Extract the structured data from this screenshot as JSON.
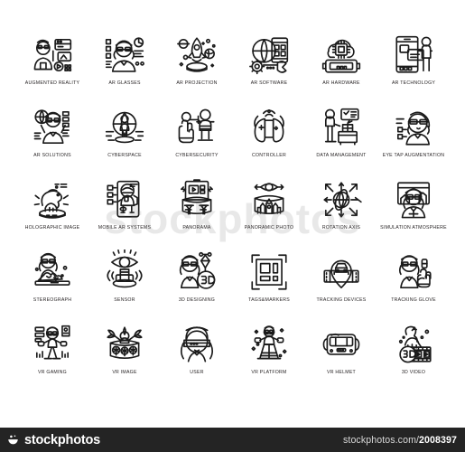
{
  "sheet": {
    "watermark_text": "stockphotos",
    "stroke_color": "#1a1a1a",
    "label_color": "#231f20",
    "background": "#ffffff"
  },
  "footer": {
    "background": "#242424",
    "brand_name": "stockphotos",
    "brand_mark": "smile-logo-icon",
    "url_prefix": "stockphotos.com/",
    "url_id": "2008397"
  },
  "grid": {
    "columns": 6,
    "rows": 5,
    "icons": [
      {
        "id": "augmented-reality",
        "icon": "man-vr-headset-dashboard-icon",
        "label": "AUGMENTED REALITY"
      },
      {
        "id": "ar-glasses",
        "icon": "woman-ar-glasses-icon",
        "label": "AR GLASSES"
      },
      {
        "id": "ar-projection",
        "icon": "rocket-planets-projection-icon",
        "label": "AR PROJECTION"
      },
      {
        "id": "ar-software",
        "icon": "globe-gear-wrench-icon",
        "label": "AR SOFTWARE"
      },
      {
        "id": "ar-hardware",
        "icon": "cloud-chip-device-icon",
        "label": "AR HARDWARE"
      },
      {
        "id": "ar-technology",
        "icon": "phone-person-screen-icon",
        "label": "AR TECHNOLOGY"
      },
      {
        "id": "ar-solutions",
        "icon": "woman-holding-globe-icon",
        "label": "AR SOLUTIONS"
      },
      {
        "id": "cyberspace",
        "icon": "person-inside-globe-icon",
        "label": "CYBERSPACE"
      },
      {
        "id": "cybersecurity",
        "icon": "hand-scan-person-icon",
        "label": "CYBERSECURITY"
      },
      {
        "id": "controller",
        "icon": "dual-gamepad-signal-icon",
        "label": "CONTROLLER"
      },
      {
        "id": "data-management",
        "icon": "person-desk-checklist-icon",
        "label": "DATA MANAGEMENT"
      },
      {
        "id": "eye-tap-augmentation",
        "icon": "woman-eye-tap-visor-icon",
        "label": "EYE TAP AUGMENTATION"
      },
      {
        "id": "holographic-image",
        "icon": "dinosaur-hologram-icon",
        "label": "HOLOGRAPHIC IMAGE"
      },
      {
        "id": "mobile-ar-systems",
        "icon": "astronaut-mobile-panel-icon",
        "label": "MOBILE AR SYSTEMS"
      },
      {
        "id": "panorama",
        "icon": "panorama-screen-cylinder-icon",
        "label": "PANORAMA"
      },
      {
        "id": "panoramic-photo",
        "icon": "eye-city-cylinder-icon",
        "label": "PANORAMIC PHOTO"
      },
      {
        "id": "rotation-axis",
        "icon": "globe-arrows-axis-icon",
        "label": "ROTATION AXIS"
      },
      {
        "id": "simulation-atmosphere",
        "icon": "girl-vr-scene-icon",
        "label": "SIMULATION ATMOSPHERE"
      },
      {
        "id": "stereograph",
        "icon": "woman-3d-terrain-table-icon",
        "label": "STEREOGRAPH"
      },
      {
        "id": "sensor",
        "icon": "eye-sensor-waves-icon",
        "label": "SENSOR"
      },
      {
        "id": "3d-designing",
        "icon": "designer-pen-3d-badge-icon",
        "label": "3D DESIGNING"
      },
      {
        "id": "tags-and-markers",
        "icon": "qr-marker-brackets-icon",
        "label": "TAGS&MARKERS"
      },
      {
        "id": "tracking-devices",
        "icon": "map-pin-car-route-icon",
        "label": "TRACKING DEVICES"
      },
      {
        "id": "tracking-glove",
        "icon": "woman-tracking-glove-icon",
        "label": "TRACKING GLOVE"
      },
      {
        "id": "vr-gaming",
        "icon": "player-vr-controllers-icon",
        "label": "VR GAMING"
      },
      {
        "id": "vr-image",
        "icon": "person-nature-cylinder-icon",
        "label": "VR IMAGE"
      },
      {
        "id": "user",
        "icon": "woman-vr-visor-portrait-icon",
        "label": "USER"
      },
      {
        "id": "vr-platform",
        "icon": "person-vr-platform-icon",
        "label": "VR PLATFORM"
      },
      {
        "id": "vr-helmet",
        "icon": "vr-helmet-front-icon",
        "label": "VR HELMET"
      },
      {
        "id": "3d-video",
        "icon": "film-strip-3d-dino-icon",
        "label": "3D VIDEO"
      }
    ]
  }
}
